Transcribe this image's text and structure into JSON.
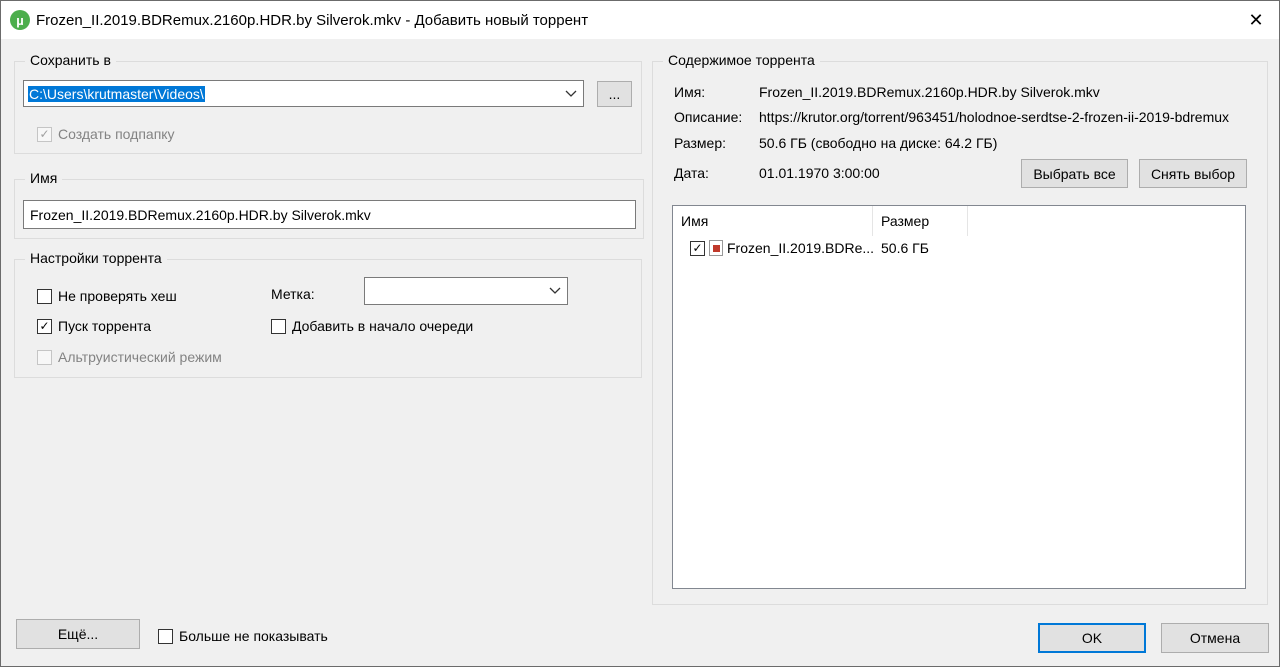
{
  "window": {
    "title": "Frozen_II.2019.BDRemux.2160p.HDR.by Silverok.mkv - Добавить новый торрент",
    "close": "✕"
  },
  "save_to": {
    "group_label": "Сохранить в",
    "path": "C:\\Users\\krutmaster\\Videos\\",
    "browse_label": "...",
    "create_subfolder_label": "Создать подпапку",
    "create_subfolder_checked": true
  },
  "name_group": {
    "group_label": "Имя",
    "value": "Frozen_II.2019.BDRemux.2160p.HDR.by Silverok.mkv"
  },
  "settings": {
    "group_label": "Настройки торрента",
    "skip_hash_label": "Не проверять хеш",
    "start_torrent_label": "Пуск торрента",
    "altruistic_label": "Альтруистический режим",
    "label_label": "Метка:",
    "label_value": "",
    "queue_top_label": "Добавить в начало очереди"
  },
  "contents": {
    "group_label": "Содержимое торрента",
    "name_key": "Имя:",
    "name_value": "Frozen_II.2019.BDRemux.2160p.HDR.by Silverok.mkv",
    "desc_key": "Описание:",
    "desc_value": "https://krutor.org/torrent/963451/holodnoe-serdtse-2-frozen-ii-2019-bdremux",
    "size_key": "Размер:",
    "size_value": "50.6 ГБ (свободно на диске: 64.2 ГБ)",
    "date_key": "Дата:",
    "date_value": "01.01.1970 3:00:00",
    "select_all_label": "Выбрать все",
    "deselect_label": "Снять выбор",
    "columns": {
      "name": "Имя",
      "size": "Размер"
    },
    "files": [
      {
        "name": "Frozen_II.2019.BDRe...",
        "size": "50.6 ГБ",
        "checked": true
      }
    ]
  },
  "footer": {
    "more_label": "Ещё...",
    "dont_show_label": "Больше не показывать",
    "ok_label": "OK",
    "cancel_label": "Отмена"
  },
  "icons": {
    "check": "✓",
    "chevron": "⌄"
  },
  "colors": {
    "accent": "#0078d7",
    "dialog_bg": "#f0f0f0",
    "app_icon": "#4cae4c"
  }
}
